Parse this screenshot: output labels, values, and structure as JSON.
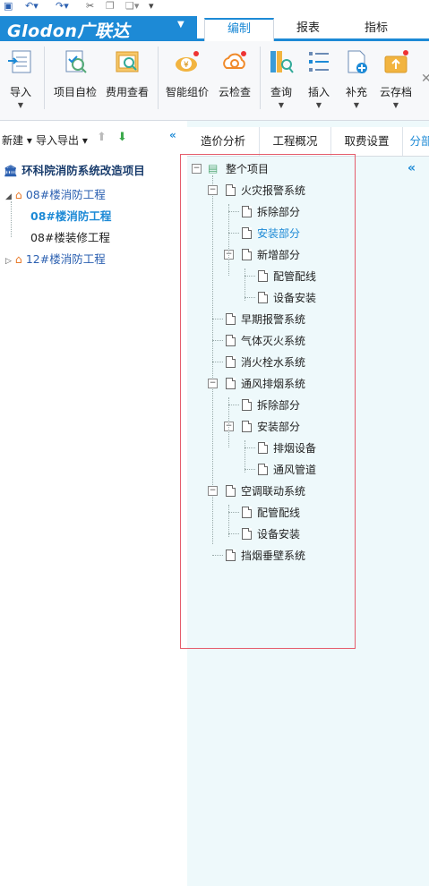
{
  "app": {
    "brand": "Glodon广联达",
    "main_tabs": [
      "编制",
      "报表",
      "指标"
    ],
    "active_tab": "编制"
  },
  "toolbar": {
    "buttons": [
      {
        "label": "导入",
        "icon": "import-icon",
        "dropdown": true
      },
      {
        "label": "项目自检",
        "icon": "project-check-icon",
        "dropdown": false
      },
      {
        "label": "费用查看",
        "icon": "cost-view-icon",
        "dropdown": false
      },
      {
        "label": "智能组价",
        "icon": "smart-pricing-icon",
        "dropdown": false
      },
      {
        "label": "云检查",
        "icon": "cloud-check-icon",
        "dropdown": false
      },
      {
        "label": "查询",
        "icon": "query-icon",
        "dropdown": true
      },
      {
        "label": "插入",
        "icon": "insert-icon",
        "dropdown": true
      },
      {
        "label": "补充",
        "icon": "supplement-icon",
        "dropdown": true
      },
      {
        "label": "云存档",
        "icon": "cloud-archive-icon",
        "dropdown": true
      }
    ]
  },
  "left": {
    "new_label": "新建",
    "import_export_label": "导入导出",
    "project_name": "环科院消防系统改造项目",
    "tree": [
      {
        "label": "08#楼消防工程",
        "level": 1
      },
      {
        "label": "08#楼消防工程",
        "level": 2,
        "selected": true
      },
      {
        "label": "08#楼装修工程",
        "level": 2
      },
      {
        "label": "12#楼消防工程",
        "level": 1
      }
    ]
  },
  "right": {
    "tabs": [
      "造价分析",
      "工程概况",
      "取费设置",
      "分部"
    ],
    "active_tab": "分部",
    "tree": {
      "root": "整个项目",
      "items": [
        {
          "label": "火灾报警系统",
          "level": 1
        },
        {
          "label": "拆除部分",
          "level": 2
        },
        {
          "label": "安装部分",
          "level": 2,
          "highlight": true
        },
        {
          "label": "新增部分",
          "level": 2
        },
        {
          "label": "配管配线",
          "level": 3
        },
        {
          "label": "设备安装",
          "level": 3
        },
        {
          "label": "早期报警系统",
          "level": 1
        },
        {
          "label": "气体灭火系统",
          "level": 1
        },
        {
          "label": "消火栓水系统",
          "level": 1
        },
        {
          "label": "通风排烟系统",
          "level": 1
        },
        {
          "label": "拆除部分",
          "level": 2
        },
        {
          "label": "安装部分",
          "level": 2
        },
        {
          "label": "排烟设备",
          "level": 3
        },
        {
          "label": "通风管道",
          "level": 3
        },
        {
          "label": "空调联动系统",
          "level": 1
        },
        {
          "label": "配管配线",
          "level": 2
        },
        {
          "label": "设备安装",
          "level": 2
        },
        {
          "label": "挡烟垂壁系统",
          "level": 1
        }
      ]
    }
  }
}
